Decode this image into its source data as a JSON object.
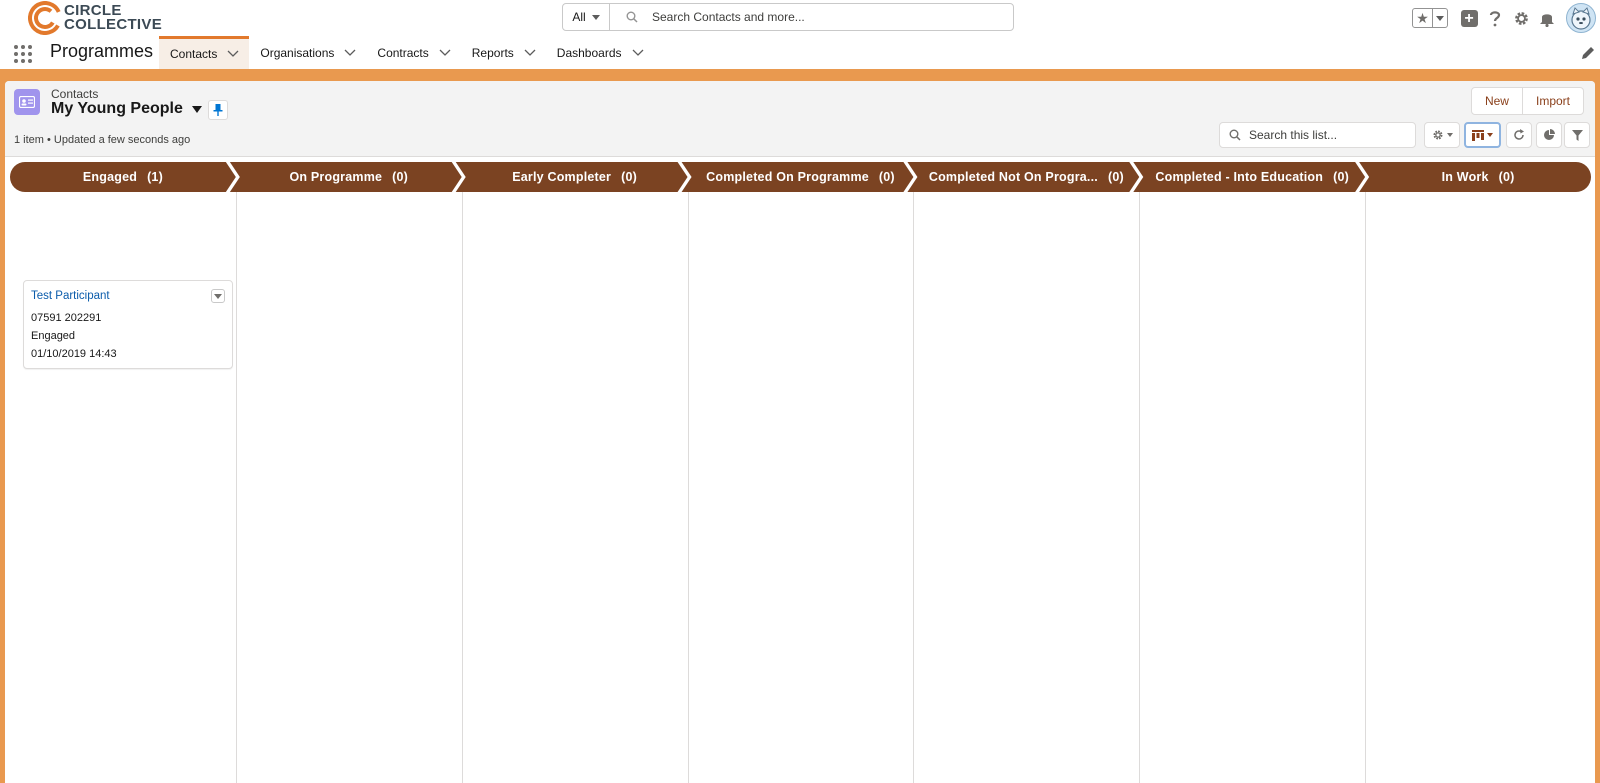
{
  "brand": {
    "line1": "CIRCLE",
    "line2": "COLLECTIVE",
    "accent_color": "#e2792c"
  },
  "search": {
    "scope": "All",
    "placeholder": "Search Contacts and more..."
  },
  "header_icons": [
    "star-icon",
    "add-icon",
    "help-icon",
    "gear-icon",
    "bell-icon",
    "avatar"
  ],
  "app": {
    "name": "Programmes"
  },
  "nav": {
    "items": [
      {
        "label": "Contacts",
        "active": true
      },
      {
        "label": "Organisations"
      },
      {
        "label": "Contracts"
      },
      {
        "label": "Reports"
      },
      {
        "label": "Dashboards"
      }
    ]
  },
  "list": {
    "object": "Contacts",
    "view": "My Young People",
    "meta": "1 item • Updated a few seconds ago",
    "actions": {
      "new": "New",
      "import": "Import"
    },
    "search_placeholder": "Search this list..."
  },
  "kanban": {
    "stage_color": "#7b4322",
    "stages": [
      {
        "name": "Engaged",
        "count": "(1)"
      },
      {
        "name": "On Programme",
        "count": "(0)"
      },
      {
        "name": "Early Completer",
        "count": "(0)"
      },
      {
        "name": "Completed On Programme",
        "count": "(0)"
      },
      {
        "name": "Completed Not On Progra...",
        "count": "(0)"
      },
      {
        "name": "Completed - Into Education",
        "count": "(0)"
      },
      {
        "name": "In Work",
        "count": "(0)"
      }
    ],
    "cards": [
      {
        "title": "Test Participant",
        "phone": "07591 202291",
        "status": "Engaged",
        "date": "01/10/2019 14:43"
      }
    ]
  }
}
